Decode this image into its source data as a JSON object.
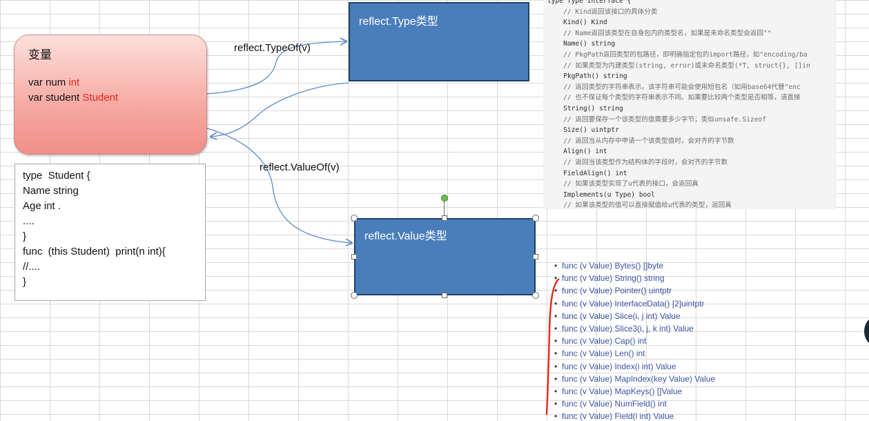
{
  "variables_box": {
    "title": "变量",
    "line1_prefix": "var num ",
    "line1_type": "int",
    "line2_prefix": "var student ",
    "line2_type": "Student"
  },
  "struct_code": [
    "type  Student {",
    "Name string",
    "Age int .",
    "....",
    "}",
    "func  (this Student)  print(n int){",
    "//....",
    "}"
  ],
  "type_box": {
    "label": "reflect.Type类型"
  },
  "value_box": {
    "label": "reflect.Value类型"
  },
  "arrows": {
    "typeof_label": "reflect.TypeOf(v)",
    "valueof_label": "reflect.ValueOf(v)"
  },
  "type_interface_code": [
    {
      "text": "type Type interface {",
      "kind": "kw"
    },
    {
      "text": "    // Kind返回该接口的具体分类",
      "kind": "cm"
    },
    {
      "text": "    Kind() Kind",
      "kind": "kw"
    },
    {
      "text": "    // Name返回该类型在自身包内的类型名，如果是未命名类型会返回\"\"",
      "kind": "cm"
    },
    {
      "text": "    Name() string",
      "kind": "kw"
    },
    {
      "text": "    // PkgPath返回类型的包路径，即明确指定包的import路径，如\"encoding/ba",
      "kind": "cm"
    },
    {
      "text": "    // 如果类型为内建类型(string, error)或未命名类型(*T, struct{}, []in",
      "kind": "cm"
    },
    {
      "text": "    PkgPath() string",
      "kind": "kw"
    },
    {
      "text": "    // 返回类型的字符串表示。该字符串可能会使用短包名（如用base64代替\"enc",
      "kind": "cm"
    },
    {
      "text": "    // 也不保证每个类型的字符串表示不同。如果要比较两个类型是否相等，请直接",
      "kind": "cm"
    },
    {
      "text": "    String() string",
      "kind": "kw"
    },
    {
      "text": "    // 返回要保存一个该类型的值需要多少字节；类似unsafe.Sizeof",
      "kind": "cm"
    },
    {
      "text": "    Size() uintptr",
      "kind": "kw"
    },
    {
      "text": "    // 返回当从内存中申请一个该类型值时，会对齐的字节数",
      "kind": "cm"
    },
    {
      "text": "    Align() int",
      "kind": "kw"
    },
    {
      "text": "    // 返回当该类型作为结构体的字段时，会对齐的字节数",
      "kind": "cm"
    },
    {
      "text": "    FieldAlign() int",
      "kind": "kw"
    },
    {
      "text": "    // 如果该类型实现了u代表的接口，会返回真",
      "kind": "cm"
    },
    {
      "text": "    Implements(u Type) bool",
      "kind": "kw"
    },
    {
      "text": "    // 如果该类型的值可以直接赋值给u代表的类型，返回真",
      "kind": "cm"
    }
  ],
  "value_methods": [
    "func (v Value) Bytes() []byte",
    "func (v Value) String() string",
    "func (v Value) Pointer() uintptr",
    "func (v Value) InterfaceData() [2]uintptr",
    "func (v Value) Slice(i, j int) Value",
    "func (v Value) Slice3(i, j, k int) Value",
    "func (v Value) Cap() int",
    "func (v Value) Len() int",
    "func (v Value) Index(i int) Value",
    "func (v Value) MapIndex(key Value) Value",
    "func (v Value) MapKeys() []Value",
    "func (v Value) NumField() int",
    "func (v Value) Field(i int) Value"
  ],
  "colors": {
    "box_fill": "#4a7ebb",
    "highlight": "#e8261a",
    "method_link": "#3b52a6"
  }
}
